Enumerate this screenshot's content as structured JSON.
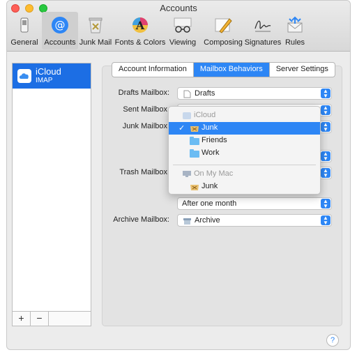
{
  "window": {
    "title": "Accounts"
  },
  "toolbar": {
    "items": [
      {
        "label": "General",
        "icon": "general-switch-icon"
      },
      {
        "label": "Accounts",
        "icon": "at-sign-icon"
      },
      {
        "label": "Junk Mail",
        "icon": "junk-trash-icon"
      },
      {
        "label": "Fonts & Colors",
        "icon": "fonts-colors-icon"
      },
      {
        "label": "Viewing",
        "icon": "glasses-icon"
      },
      {
        "label": "Composing",
        "icon": "pencil-icon"
      },
      {
        "label": "Signatures",
        "icon": "signature-icon"
      },
      {
        "label": "Rules",
        "icon": "rules-envelope-icon"
      }
    ],
    "selected": "Accounts"
  },
  "sidebar": {
    "accounts": [
      {
        "name": "iCloud",
        "type": "IMAP"
      }
    ],
    "add_label": "+",
    "remove_label": "−"
  },
  "tabs": {
    "items": [
      "Account Information",
      "Mailbox Behaviors",
      "Server Settings"
    ],
    "active": "Mailbox Behaviors"
  },
  "fields": {
    "drafts": {
      "label": "Drafts Mailbox:",
      "value": "Drafts"
    },
    "sent": {
      "label": "Sent Mailbox"
    },
    "junk": {
      "label": "Junk Mailbox"
    },
    "trash": {
      "label": "Trash Mailbox"
    },
    "erase_after": {
      "value": "After one month"
    },
    "archive": {
      "label": "Archive Mailbox:",
      "value": "Archive"
    }
  },
  "menu": {
    "header_icloud": "iCloud",
    "items": [
      "Junk",
      "Friends",
      "Work"
    ],
    "selected": "Junk",
    "checkmark": "✓",
    "header_local": "On My Mac",
    "local_items": [
      "Junk"
    ]
  },
  "help": {
    "label": "?"
  },
  "colors": {
    "accent": "#2d86f5",
    "selection": "#1c6ee4"
  }
}
